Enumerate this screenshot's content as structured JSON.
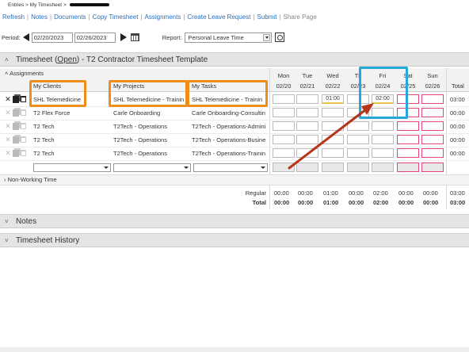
{
  "breadcrumb": {
    "entries": "Entries",
    "sep": ">",
    "my_timesheet": "My Timesheet"
  },
  "menu": [
    {
      "label": "Refresh"
    },
    {
      "label": "Notes"
    },
    {
      "label": "Documents"
    },
    {
      "label": "Copy Timesheet"
    },
    {
      "label": "Assignments"
    },
    {
      "label": "Create Leave Request"
    },
    {
      "label": "Submit"
    },
    {
      "label": "Share Page",
      "disabled": true
    }
  ],
  "period": {
    "label": "Period:",
    "start": "02/20/2023",
    "end": "02/26/2023",
    "report_label": "Report:",
    "report_value": "Personal Leave Time"
  },
  "timesheet": {
    "prefix": "Timesheet (",
    "status": "Open",
    "suffix": ") - T2 Contractor Timesheet Template"
  },
  "assignments_label": "Assignments",
  "columns": {
    "clients": "My Clients",
    "projects": "My Projects",
    "tasks": "My Tasks",
    "total": "Total"
  },
  "days": [
    {
      "name": "Mon",
      "date": "02/20"
    },
    {
      "name": "Tue",
      "date": "02/21"
    },
    {
      "name": "Wed",
      "date": "02/22"
    },
    {
      "name": "Th",
      "date": "02/23"
    },
    {
      "name": "Fri",
      "date": "02/24"
    },
    {
      "name": "Sat",
      "date": "02/25"
    },
    {
      "name": "Sun",
      "date": "02/26"
    }
  ],
  "rows": [
    {
      "client": "SHL Telemedicine",
      "project": "SHL Telemedicine - Trainin",
      "task": "SHL Telemedicine - Trainin",
      "hours": [
        "",
        "",
        "01:00",
        "",
        "02:00",
        "",
        ""
      ],
      "total": "03:00"
    },
    {
      "client": "T2 Flex Force",
      "project": "Carle Onboarding",
      "task": "Carle Onboarding-Consultin",
      "hours": [
        "",
        "",
        "",
        "",
        "",
        "",
        ""
      ],
      "total": "00:00"
    },
    {
      "client": "T2 Tech",
      "project": "T2Tech - Operations",
      "task": "T2Tech - Operations-Admini",
      "hours": [
        "",
        "",
        "",
        "",
        "",
        "",
        ""
      ],
      "total": "00:00"
    },
    {
      "client": "T2 Tech",
      "project": "T2Tech - Operations",
      "task": "T2Tech - Operations-Busine",
      "hours": [
        "",
        "",
        "",
        "",
        "",
        "",
        ""
      ],
      "total": "00:00"
    },
    {
      "client": "T2 Tech",
      "project": "T2Tech - Operations",
      "task": "T2Tech - Operations-Trainin",
      "hours": [
        "",
        "",
        "",
        "",
        "",
        "",
        ""
      ],
      "total": "00:00"
    }
  ],
  "non_working_label": "Non-Working Time",
  "totals": {
    "regular_label": "Regular",
    "total_label": "Total",
    "regular": [
      "00:00",
      "00:00",
      "01:00",
      "00:00",
      "02:00",
      "00:00",
      "00:00"
    ],
    "total": [
      "00:00",
      "00:00",
      "01:00",
      "00:00",
      "02:00",
      "00:00",
      "00:00"
    ],
    "regular_sum": "03:00",
    "total_sum": "03:00"
  },
  "sections": {
    "notes": "Notes",
    "history": "Timesheet History"
  },
  "colors": {
    "highlight_orange": "#f08c1a",
    "highlight_blue": "#25a7d8",
    "arrow_red": "#b5341a",
    "weekend_pink": "#e0457b",
    "link_blue": "#2a6ebb"
  }
}
